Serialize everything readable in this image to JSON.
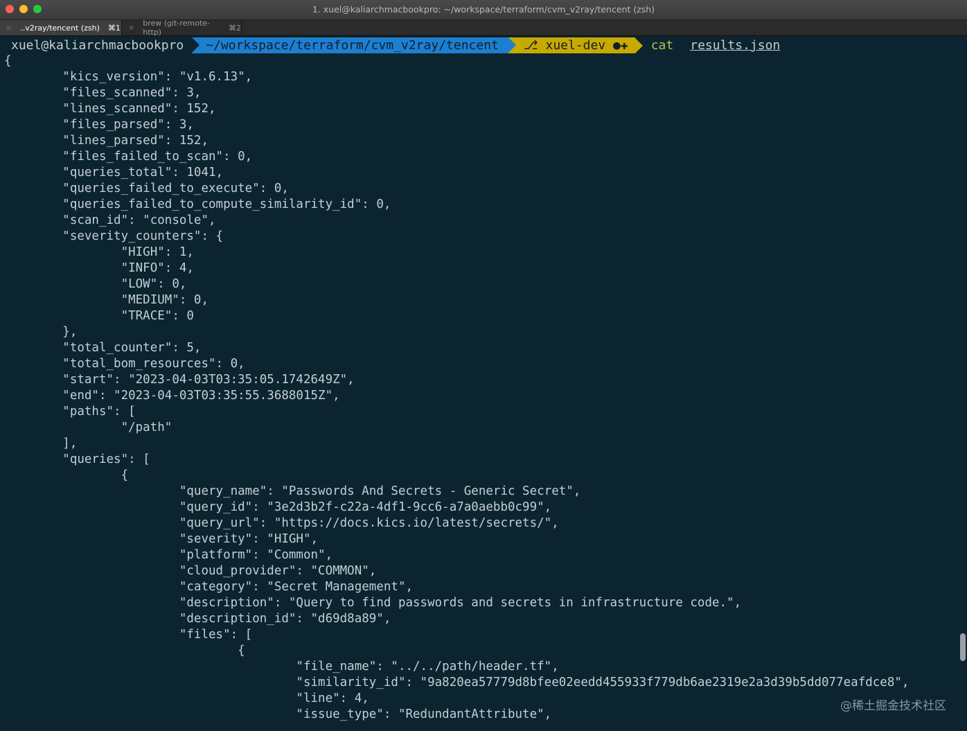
{
  "window": {
    "title": "1. xuel@kaliarchmacbookpro: ~/workspace/terraform/cvm_v2ray/tencent (zsh)"
  },
  "tabs": [
    {
      "label": "..v2ray/tencent (zsh)",
      "shortcut": "⌘1",
      "close": "✕"
    },
    {
      "label": "brew (git-remote-http)",
      "shortcut": "⌘2",
      "close": "✕"
    }
  ],
  "prompt": {
    "user_host": "xuel@kaliarchmacbookpro",
    "path": "~/workspace/terraform/cvm_v2ray/tencent",
    "git_branch": "xuel-dev",
    "git_icon": "⎇",
    "git_status": "●✚",
    "command": "cat",
    "argument": "results.json"
  },
  "output": [
    "{",
    "        \"kics_version\": \"v1.6.13\",",
    "        \"files_scanned\": 3,",
    "        \"lines_scanned\": 152,",
    "        \"files_parsed\": 3,",
    "        \"lines_parsed\": 152,",
    "        \"files_failed_to_scan\": 0,",
    "        \"queries_total\": 1041,",
    "        \"queries_failed_to_execute\": 0,",
    "        \"queries_failed_to_compute_similarity_id\": 0,",
    "        \"scan_id\": \"console\",",
    "        \"severity_counters\": {",
    "                \"HIGH\": 1,",
    "                \"INFO\": 4,",
    "                \"LOW\": 0,",
    "                \"MEDIUM\": 0,",
    "                \"TRACE\": 0",
    "        },",
    "        \"total_counter\": 5,",
    "        \"total_bom_resources\": 0,",
    "        \"start\": \"2023-04-03T03:35:05.1742649Z\",",
    "        \"end\": \"2023-04-03T03:35:55.3688015Z\",",
    "        \"paths\": [",
    "                \"/path\"",
    "        ],",
    "        \"queries\": [",
    "                {",
    "                        \"query_name\": \"Passwords And Secrets - Generic Secret\",",
    "                        \"query_id\": \"3e2d3b2f-c22a-4df1-9cc6-a7a0aebb0c99\",",
    "                        \"query_url\": \"https://docs.kics.io/latest/secrets/\",",
    "                        \"severity\": \"HIGH\",",
    "                        \"platform\": \"Common\",",
    "                        \"cloud_provider\": \"COMMON\",",
    "                        \"category\": \"Secret Management\",",
    "                        \"description\": \"Query to find passwords and secrets in infrastructure code.\",",
    "                        \"description_id\": \"d69d8a89\",",
    "                        \"files\": [",
    "                                {",
    "                                        \"file_name\": \"../../path/header.tf\",",
    "                                        \"similarity_id\": \"9a820ea57779d8bfee02eedd455933f779db6ae2319e2a3d39b5dd077eafdce8\",",
    "                                        \"line\": 4,",
    "                                        \"issue_type\": \"RedundantAttribute\","
  ],
  "watermark": "@稀土掘金技术社区"
}
